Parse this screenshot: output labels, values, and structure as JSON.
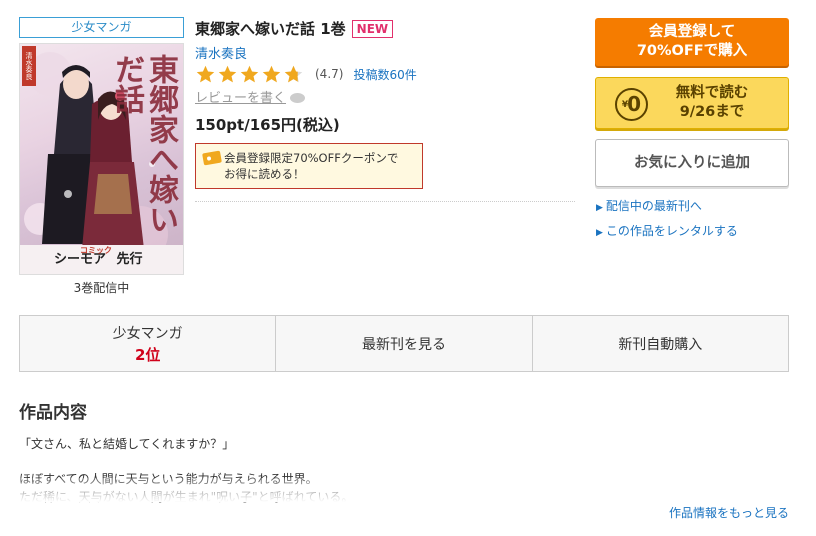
{
  "category_tag": "少女マンガ",
  "cover": {
    "title_art": "東郷家へ嫁いだ話",
    "volume_mark": "1",
    "brand": "シーモア",
    "brand_small": "コミック",
    "brand_suffix": "先行",
    "side_tag": "清水奏良"
  },
  "volume_note": "3巻配信中",
  "book": {
    "title": "東郷家へ嫁いだ話 1巻",
    "new_badge": "NEW",
    "author": "清水奏良",
    "rating": 4.7,
    "rating_text": "(4.7)",
    "review_count": "投稿数60件",
    "write_review": "レビューを書く",
    "price": "150pt/165円(税込)"
  },
  "coupon": {
    "line1": "会員登録限定70%OFFクーポンで",
    "line2": "お得に読める！"
  },
  "actions": {
    "register_line1": "会員登録して",
    "register_line2": "70%OFFで購入",
    "free_amount": "0",
    "free_line1": "無料で読む",
    "free_line2": "9/26まで",
    "favorite": "お気に入りに追加",
    "latest_link": "配信中の最新刊へ",
    "rental_link": "この作品をレンタルする"
  },
  "tabs": {
    "ranking_label": "少女マンガ",
    "ranking_value": "2位",
    "latest": "最新刊を見る",
    "auto_buy": "新刊自動購入"
  },
  "description": {
    "heading": "作品内容",
    "line1": "「文さん、私と結婚してくれますか？」",
    "line2": "ほぼすべての人間に天与という能力が与えられる世界。",
    "line3": "ただ稀に、天与がない人間が生まれ\"呪い子\"と呼ばれている。",
    "more": "作品情報をもっと見る"
  },
  "colors": {
    "accent_blue": "#1a73c0",
    "register_orange": "#f57c00",
    "free_yellow": "#fbd85c",
    "star_gold": "#f0a81f",
    "rank_red": "#d0021b"
  }
}
